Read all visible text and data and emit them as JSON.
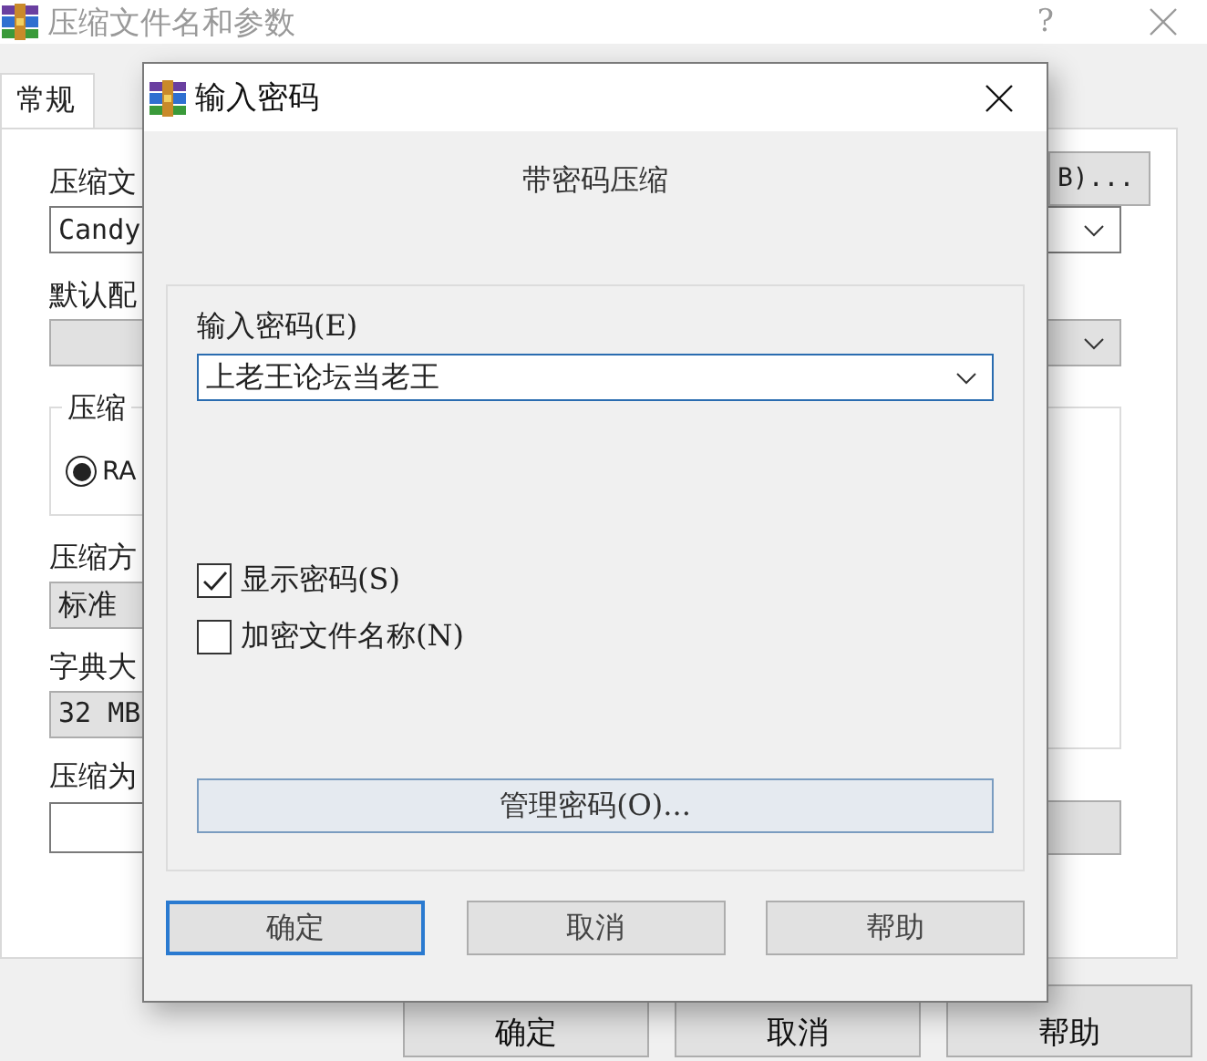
{
  "main_window": {
    "title": "压缩文件名和参数",
    "help_button": "?",
    "tabs": [
      {
        "label": "常规",
        "selected": true
      }
    ],
    "general": {
      "archive_name_label": "压缩文",
      "archive_name": "Candy",
      "browse_button": "B)...",
      "profile_label": "默认配",
      "format_group_label": "压缩",
      "format_options": [
        {
          "label": "RA",
          "selected": true
        }
      ],
      "method_label": "压缩方",
      "method": "标准",
      "dictionary_label": "字典大",
      "dictionary": "32 MB",
      "split_label": "压缩为"
    },
    "buttons": [
      {
        "label": "确定"
      },
      {
        "label": "取消"
      },
      {
        "label": "帮助"
      }
    ]
  },
  "dialog": {
    "title": "输入密码",
    "heading": "带密码压缩",
    "password_label": "输入密码(E)",
    "password": "上老王论坛当老王",
    "options": [
      {
        "label": "显示密码(S)",
        "checked": true
      },
      {
        "label": "加密文件名称(N)",
        "checked": false
      }
    ],
    "manage_button": "管理密码(O)...",
    "buttons": [
      {
        "label": "确定",
        "default": true
      },
      {
        "label": "取消",
        "default": false
      },
      {
        "label": "帮助",
        "default": false
      }
    ]
  }
}
